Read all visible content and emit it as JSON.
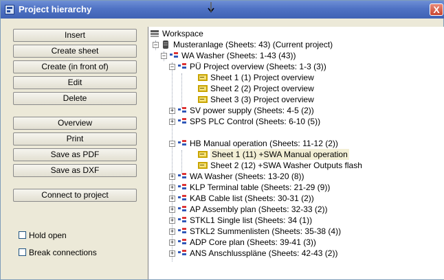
{
  "window": {
    "title": "Project hierarchy",
    "close_label": "X"
  },
  "buttons": {
    "insert": "Insert",
    "create_sheet": "Create sheet",
    "create_in_front": "Create (in front of)",
    "edit": "Edit",
    "delete": "Delete",
    "overview": "Overview",
    "print": "Print",
    "save_pdf": "Save as PDF",
    "save_dxf": "Save as DXF",
    "connect": "Connect to project"
  },
  "options": {
    "hold_open": {
      "label": "Hold open",
      "checked": false
    },
    "break_connections": {
      "label": "Break connections",
      "checked": false
    }
  },
  "tree": [
    {
      "label": "Workspace",
      "icon": "workspace-icon"
    },
    {
      "label": "Musteranlage  (Sheets: 43)  (Current project)",
      "icon": "database-icon"
    },
    {
      "label": "WA  Washer  (Sheets: 1-43 (43))",
      "icon": "group-icon"
    },
    {
      "label": "PÜ  Project overview  (Sheets: 1-3 (3))",
      "icon": "group-icon"
    },
    {
      "label": "Sheet 1 (1)  Project overview",
      "icon": "sheet-icon"
    },
    {
      "label": "Sheet 2 (2)  Project overview",
      "icon": "sheet-icon"
    },
    {
      "label": "Sheet 3 (3)  Project overview",
      "icon": "sheet-icon"
    },
    {
      "label": "SV  power supply  (Sheets: 4-5 (2))",
      "icon": "group-icon"
    },
    {
      "label": "SPS  PLC Control  (Sheets: 6-10 (5))",
      "icon": "group-icon"
    },
    {
      "label": "HB  Manual operation  (Sheets: 11-12 (2))",
      "icon": "group-icon"
    },
    {
      "label": "Sheet 1 (11)  +SWA  Manual operation",
      "icon": "sheet-icon"
    },
    {
      "label": "Sheet 2 (12)  +SWA  Washer Outputs flash",
      "icon": "sheet-icon"
    },
    {
      "label": "WA  Washer  (Sheets: 13-20 (8))",
      "icon": "group-icon"
    },
    {
      "label": "KLP  Terminal table  (Sheets: 21-29 (9))",
      "icon": "group-icon"
    },
    {
      "label": "KAB  Cable list  (Sheets: 30-31 (2))",
      "icon": "group-icon"
    },
    {
      "label": "AP  Assembly plan  (Sheets: 32-33 (2))",
      "icon": "group-icon"
    },
    {
      "label": "STKL1  Single list  (Sheets: 34 (1))",
      "icon": "group-icon"
    },
    {
      "label": "STKL2  Summenlisten  (Sheets: 35-38 (4))",
      "icon": "group-icon"
    },
    {
      "label": "ADP  Core plan  (Sheets: 39-41 (3))",
      "icon": "group-icon"
    },
    {
      "label": "ANS  Anschlusspläne  (Sheets: 42-43 (2))",
      "icon": "group-icon"
    }
  ],
  "selected_node": "Sheet 1 (11)  +SWA  Manual operation",
  "colors": {
    "title_bar": "#4f72c4",
    "panel": "#ece9d8",
    "selection": "#f3efd5"
  }
}
